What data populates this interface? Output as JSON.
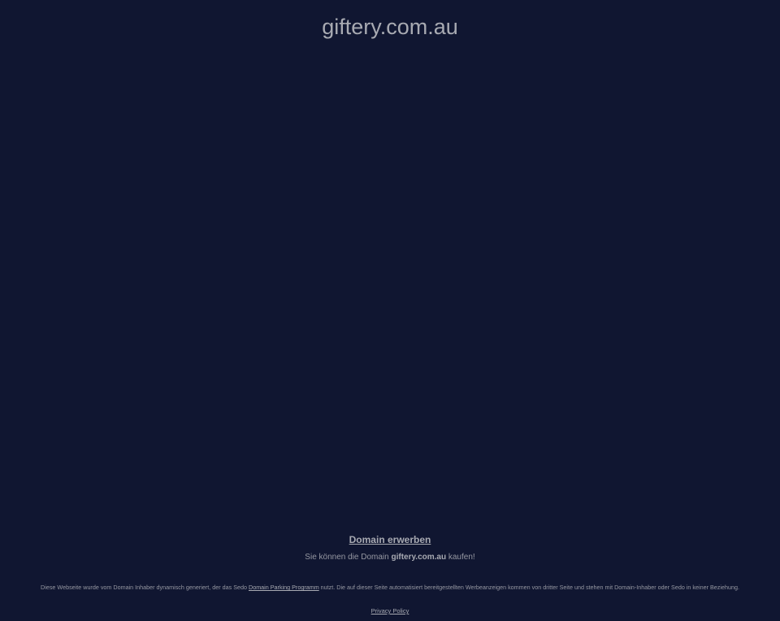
{
  "header": {
    "domain": "giftery.com.au"
  },
  "buy": {
    "link_label": "Domain erwerben",
    "text_prefix": "Sie können die Domain ",
    "text_domain": "giftery.com.au",
    "text_suffix": " kaufen!"
  },
  "disclaimer": {
    "part1": "Diese Webseite wurde vom Domain Inhaber dynamisch generiert, der das Sedo ",
    "link_label": "Domain Parking Programm",
    "part2": " nutzt. Die auf dieser Seite automatisiert bereitgestellten Werbeanzeigen kommen von dritter Seite und stehen mit Domain-Inhaber oder Sedo in keiner Beziehung."
  },
  "footer": {
    "privacy_label": "Privacy Policy"
  },
  "colors": {
    "background": "#101631",
    "text": "#a8aab2"
  }
}
